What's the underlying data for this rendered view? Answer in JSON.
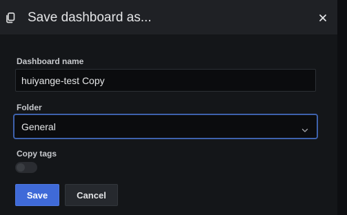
{
  "dialog": {
    "title": "Save dashboard as...",
    "icons": {
      "header": "copy-icon",
      "close": "close-icon"
    }
  },
  "form": {
    "dashboard_name": {
      "label": "Dashboard name",
      "value": "huiyange-test Copy"
    },
    "folder": {
      "label": "Folder",
      "selected": "General",
      "icon": "chevron-down-icon"
    },
    "copy_tags": {
      "label": "Copy tags",
      "enabled": false
    }
  },
  "actions": {
    "save_label": "Save",
    "cancel_label": "Cancel"
  },
  "colors": {
    "accent": "#3f6ad8",
    "focus_border": "#3e62ad",
    "background": "#141619",
    "header_background": "#1f2125"
  }
}
